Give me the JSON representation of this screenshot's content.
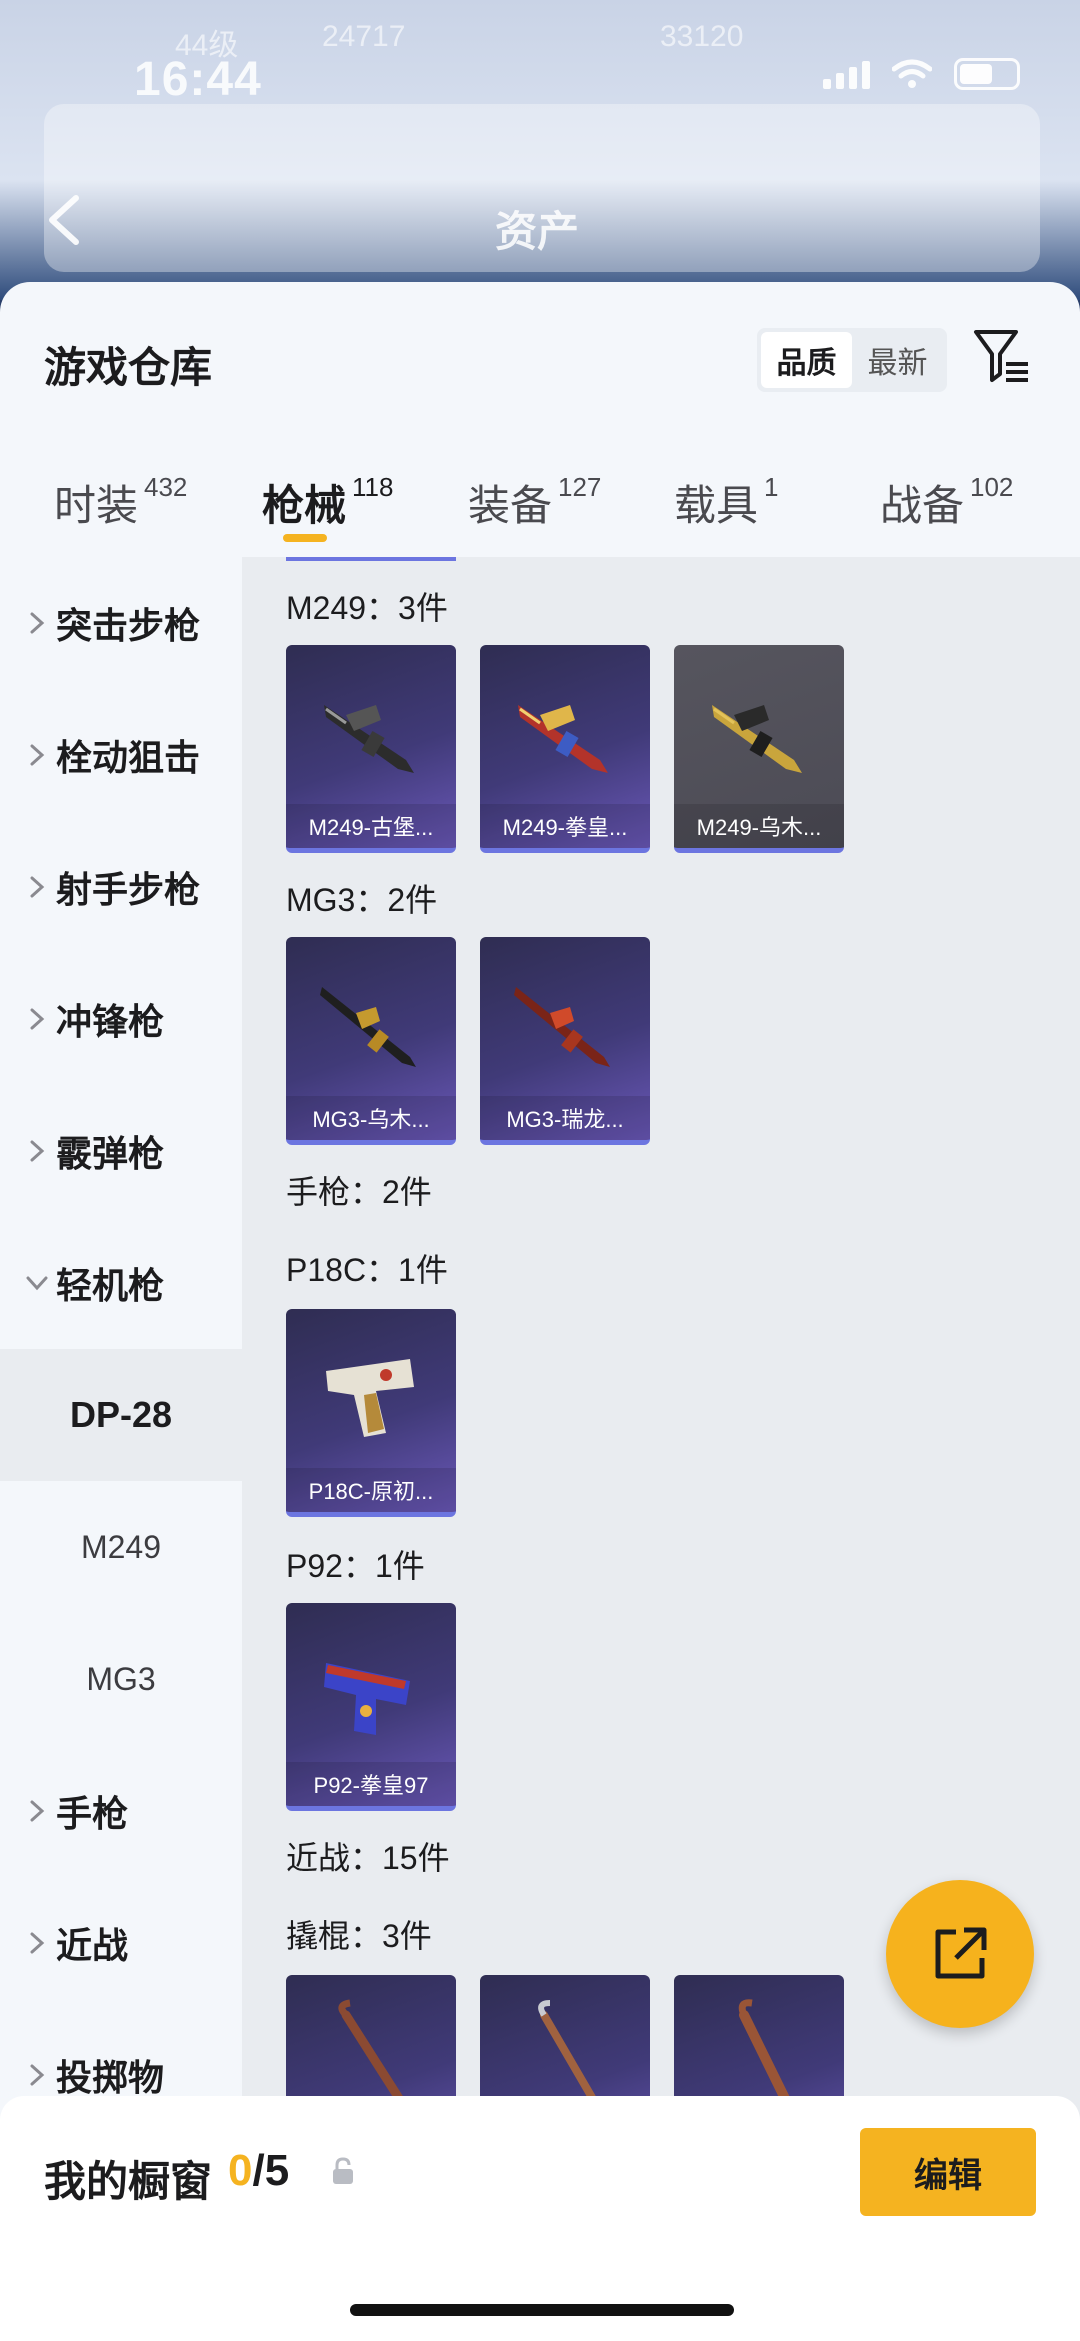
{
  "status_bar": {
    "time": "16:44"
  },
  "background": {
    "top_texts": [
      "44级",
      "24717",
      "33120"
    ],
    "page_title": "资产"
  },
  "sheet": {
    "title": "游戏仓库",
    "sort": {
      "quality": "品质",
      "newest": "最新",
      "selected": "品质"
    }
  },
  "tabs": [
    {
      "label": "时装",
      "count": "432"
    },
    {
      "label": "枪械",
      "count": "118",
      "active": true
    },
    {
      "label": "装备",
      "count": "127"
    },
    {
      "label": "载具",
      "count": "1"
    },
    {
      "label": "战备",
      "count": "102"
    }
  ],
  "categories": [
    {
      "label": "突击步枪",
      "expanded": false
    },
    {
      "label": "栓动狙击",
      "expanded": false
    },
    {
      "label": "射手步枪",
      "expanded": false
    },
    {
      "label": "冲锋枪",
      "expanded": false
    },
    {
      "label": "霰弹枪",
      "expanded": false
    },
    {
      "label": "轻机枪",
      "expanded": true
    },
    {
      "label": "手枪",
      "expanded": false
    },
    {
      "label": "近战",
      "expanded": false
    },
    {
      "label": "投掷物",
      "expanded": false
    }
  ],
  "subcategories": [
    {
      "label": "DP-28",
      "active": true
    },
    {
      "label": "M249"
    },
    {
      "label": "MG3"
    }
  ],
  "sections": [
    {
      "label": "M249：3件",
      "items": [
        "M249-古堡...",
        "M249-拳皇...",
        "M249-乌木..."
      ]
    },
    {
      "label": "MG3：2件",
      "items": [
        "MG3-乌木...",
        "MG3-瑞龙..."
      ]
    },
    {
      "label": "手枪：2件",
      "items": []
    },
    {
      "label": "P18C：1件",
      "items": [
        "P18C-原初..."
      ]
    },
    {
      "label": "P92：1件",
      "items": [
        "P92-拳皇97"
      ]
    },
    {
      "label": "近战：15件",
      "items": []
    },
    {
      "label": "撬棍：3件",
      "items": [
        "",
        "",
        ""
      ]
    }
  ],
  "showcase": {
    "label": "我的橱窗",
    "current": "0",
    "total": "/5"
  },
  "edit_button": "编辑",
  "colors": {
    "accent": "#f5b320",
    "item_border": "#6c75e0",
    "item_bg": "#403a78"
  }
}
